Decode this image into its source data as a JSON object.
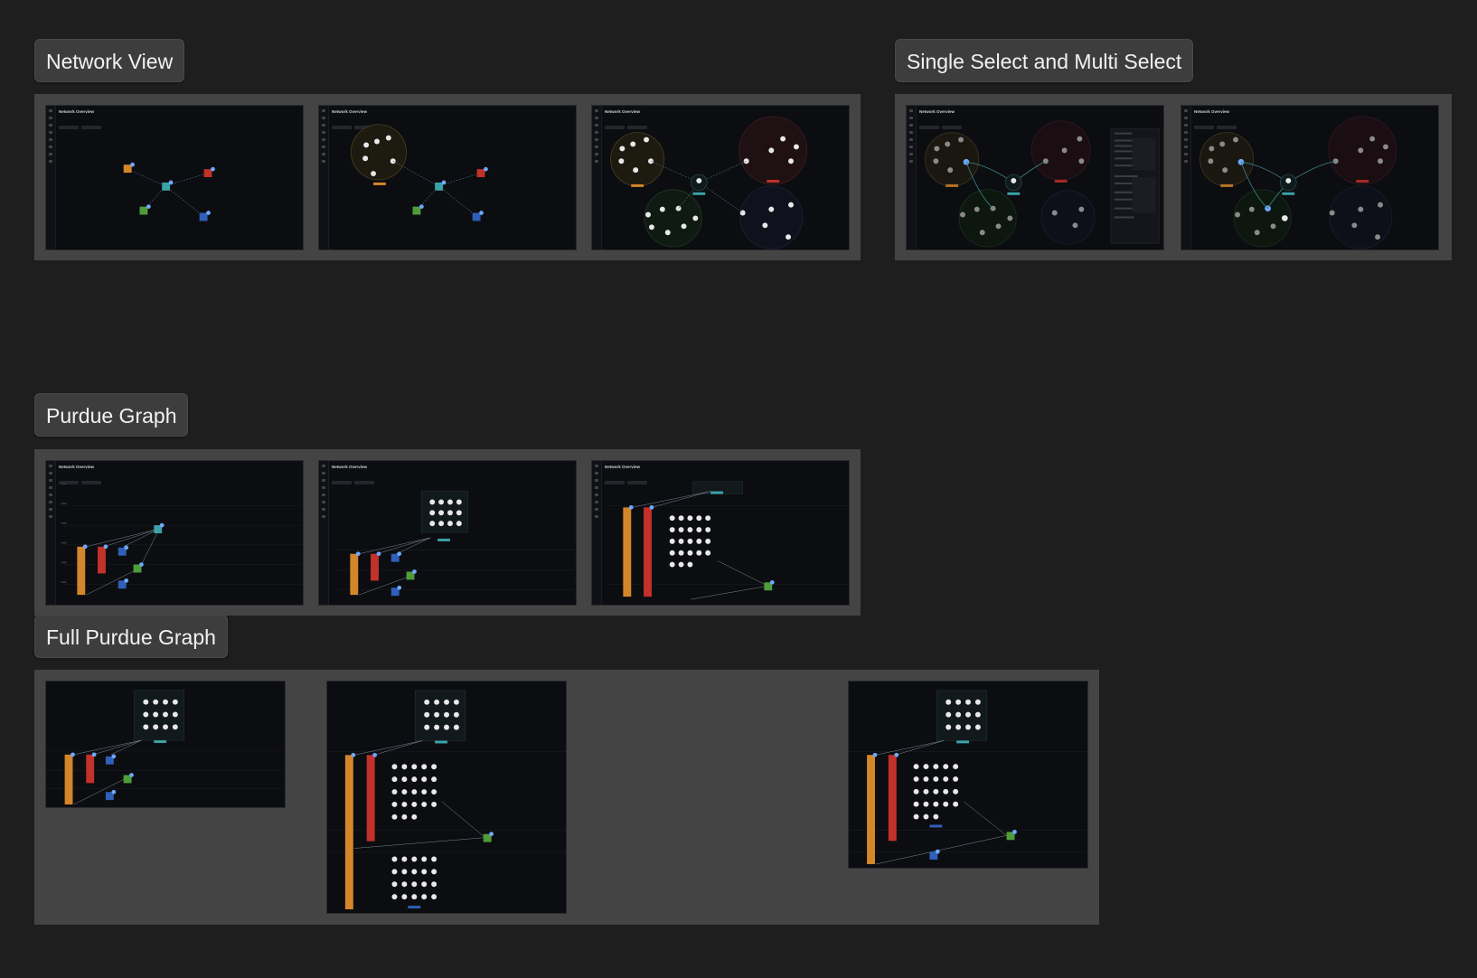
{
  "sections": {
    "network_view": {
      "label": "Network View"
    },
    "single_multi_select": {
      "label": "Single Select and Multi Select"
    },
    "purdue_graph": {
      "label": "Purdue Graph"
    },
    "full_purdue_graph": {
      "label": "Full Purdue Graph"
    }
  },
  "thumbnail": {
    "title": "Network Overview"
  },
  "colors": {
    "page_bg": "#1e1e1e",
    "frame_bg": "#444444",
    "label_bg": "#3d3d3d",
    "shot_bg": "#0c0d11",
    "orange": "#d4862a",
    "red": "#c2312a",
    "teal": "#3aa3a8",
    "green": "#4f9d3a",
    "blue": "#2f5fb8",
    "node_dot": "#6ea8ff"
  }
}
